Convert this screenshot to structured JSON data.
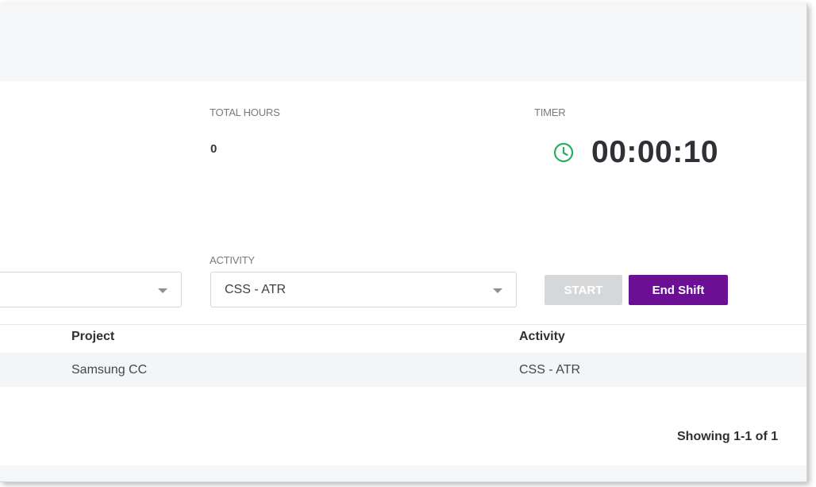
{
  "stats": {
    "total_hours_label": "TOTAL HOURS",
    "total_hours_value": "0",
    "timer_label": "TIMER",
    "timer_value": "00:00:10",
    "timer_icon": "clock-icon",
    "timer_icon_color": "#27ae60"
  },
  "form": {
    "left_select_value": "",
    "activity_label": "ACTIVITY",
    "activity_value": "CSS - ATR",
    "start_label": "START",
    "end_shift_label": "End Shift",
    "end_shift_color": "#6b0f94",
    "start_disabled_color": "#d6d7d9"
  },
  "table": {
    "columns": [
      "Project",
      "Activity"
    ],
    "rows": [
      [
        "Samsung CC",
        "CSS - ATR"
      ]
    ]
  },
  "pagination": {
    "text": "Showing 1-1 of 1"
  }
}
